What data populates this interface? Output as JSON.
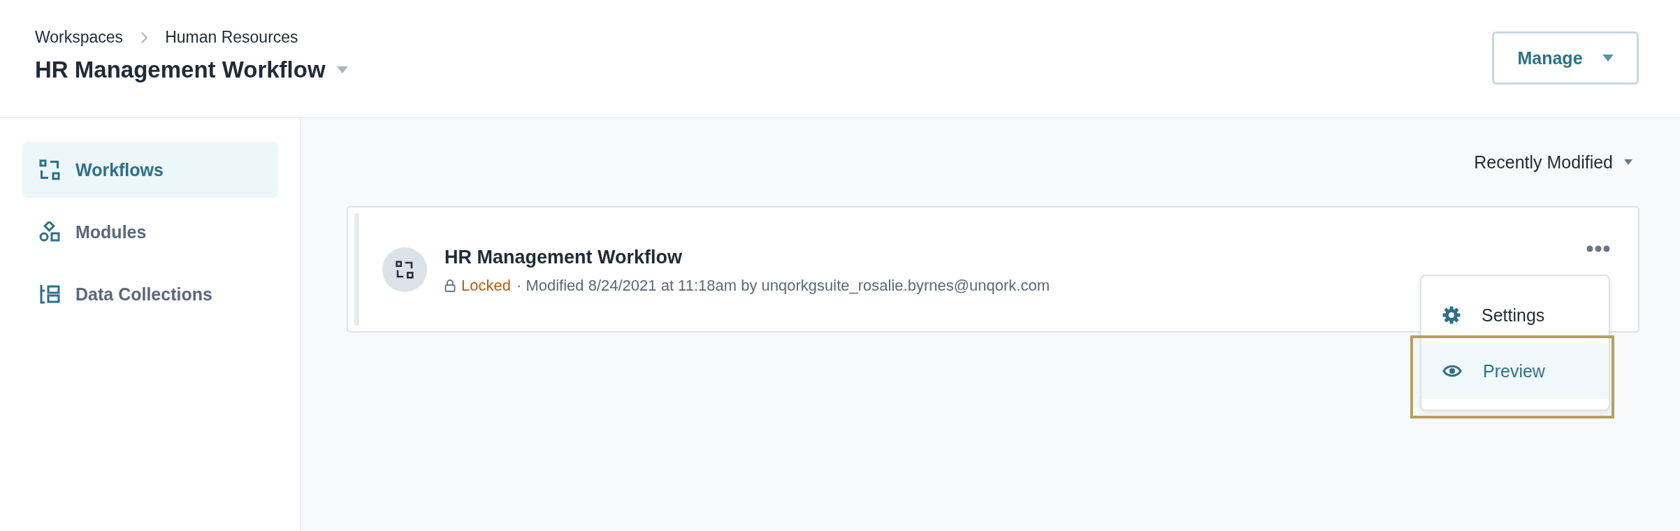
{
  "breadcrumb": [
    "Workspaces",
    "Human Resources"
  ],
  "page_title": "HR Management Workflow",
  "manage_button": "Manage",
  "sidebar": {
    "items": [
      {
        "label": "Workflows",
        "kind": "workflows",
        "selected": true
      },
      {
        "label": "Modules",
        "kind": "modules",
        "selected": false
      },
      {
        "label": "Data Collections",
        "kind": "collections",
        "selected": false
      }
    ]
  },
  "sort": "Recently Modified",
  "workflows": [
    {
      "title": "HR Management Workflow",
      "status": "Locked",
      "locked": true,
      "modified": "· Modified 8/24/2021 at 11:18am by unqorkgsuite_rosalie.byrnes@unqork.com",
      "menu": [
        {
          "label": "Settings",
          "kind": "settings",
          "selected": false
        },
        {
          "label": "Preview",
          "kind": "preview",
          "selected": true
        }
      ]
    }
  ]
}
